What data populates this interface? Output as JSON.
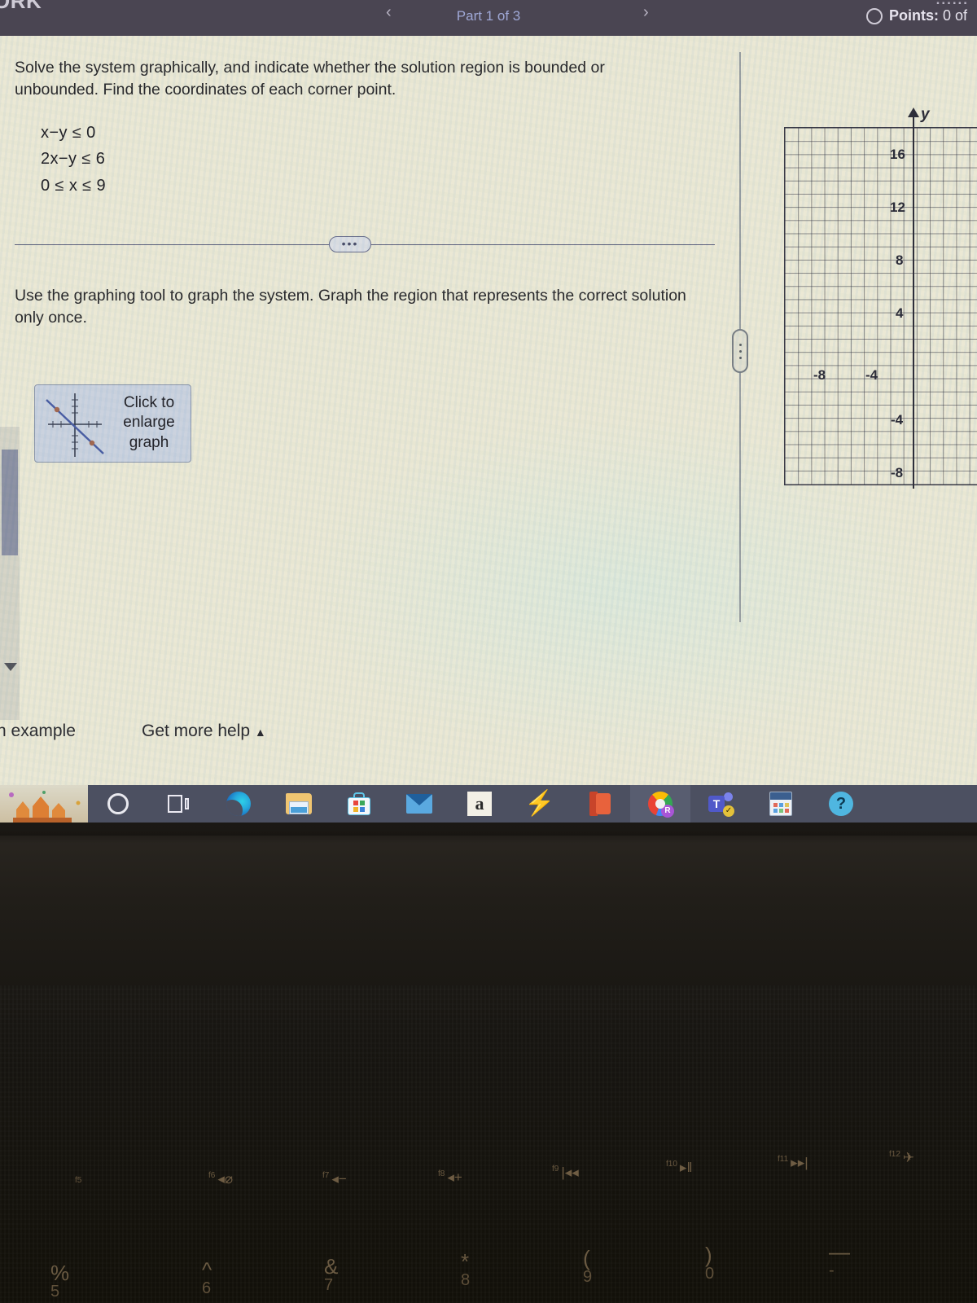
{
  "header": {
    "title_cut": "ORK",
    "part_label": "Part 1 of 3",
    "prev_chevron": "‹",
    "next_chevron": "›",
    "points_label": "Points:",
    "points_value": "0 of",
    "top_cut": "......"
  },
  "question": {
    "prompt": "Solve the system graphically, and indicate whether the solution region is bounded or unbounded. Find the coordinates of each corner point.",
    "equations": [
      "x−y ≤ 0",
      "2x−y ≤ 6",
      "0 ≤ x ≤ 9"
    ],
    "ellipsis": "•••",
    "instruction": "Use the graphing tool to graph the system. Graph the region that represents the correct solution only once.",
    "enlarge_button_label": "Click to enlarge graph"
  },
  "footer": {
    "example_link": "n example",
    "help_link": "Get more help",
    "help_caret": "▲"
  },
  "chart_data": {
    "type": "scatter",
    "title": "",
    "xlabel": "",
    "ylabel": "y",
    "grid": true,
    "legend": "none",
    "xlim": [
      -12,
      3
    ],
    "ylim": [
      -10,
      18
    ],
    "x_ticks": [
      -8,
      -4
    ],
    "y_ticks": [
      16,
      12,
      8,
      4,
      -4,
      -8
    ],
    "x_tick_labels": [
      "-8",
      "-4"
    ],
    "y_tick_labels": [
      "16",
      "12",
      "8",
      "4",
      "-4",
      "-8"
    ],
    "tick_step": 4,
    "minor_grid_step": 1,
    "series": [],
    "annotations": [
      "y-axis arrow at top labeled y"
    ]
  },
  "taskbar": {
    "icons": [
      {
        "name": "cortana-icon",
        "label": "Cortana"
      },
      {
        "name": "task-view-icon",
        "label": "Task View"
      },
      {
        "name": "edge-icon",
        "label": "Microsoft Edge"
      },
      {
        "name": "file-explorer-icon",
        "label": "File Explorer"
      },
      {
        "name": "microsoft-store-icon",
        "label": "Microsoft Store"
      },
      {
        "name": "mail-icon",
        "label": "Mail"
      },
      {
        "name": "amazon-icon",
        "label": "a"
      },
      {
        "name": "lightning-icon",
        "label": "Lightning"
      },
      {
        "name": "office-icon",
        "label": "Office"
      },
      {
        "name": "chrome-icon",
        "label": "Chrome"
      },
      {
        "name": "teams-icon",
        "label": "T"
      },
      {
        "name": "calculator-icon",
        "label": "Calculator"
      },
      {
        "name": "help-icon",
        "label": "?"
      }
    ]
  },
  "keyboard": {
    "fn_keys": [
      {
        "num": "f5",
        "glyph": ""
      },
      {
        "num": "f6",
        "glyph": "◂⌀"
      },
      {
        "num": "f7",
        "glyph": "◂−"
      },
      {
        "num": "f8",
        "glyph": "◂+"
      },
      {
        "num": "f9",
        "glyph": "|◂◂"
      },
      {
        "num": "f10",
        "glyph": "▸‖"
      },
      {
        "num": "f11",
        "glyph": "▸▸|"
      },
      {
        "num": "f12",
        "glyph": "✈"
      }
    ],
    "number_keys": [
      "%",
      "^",
      "&",
      "*",
      "(",
      ")",
      "—"
    ],
    "number_subs": [
      "5",
      "6",
      "7",
      "8",
      "9",
      "0",
      "-"
    ]
  },
  "colors": {
    "header_bg": "#4a4552",
    "part_text": "#9fa8d6",
    "page_bg": "#eceada",
    "taskbar_bg": "#4c5061",
    "button_bg": "#ccd4e4",
    "grid_line": "#3a3a48"
  }
}
